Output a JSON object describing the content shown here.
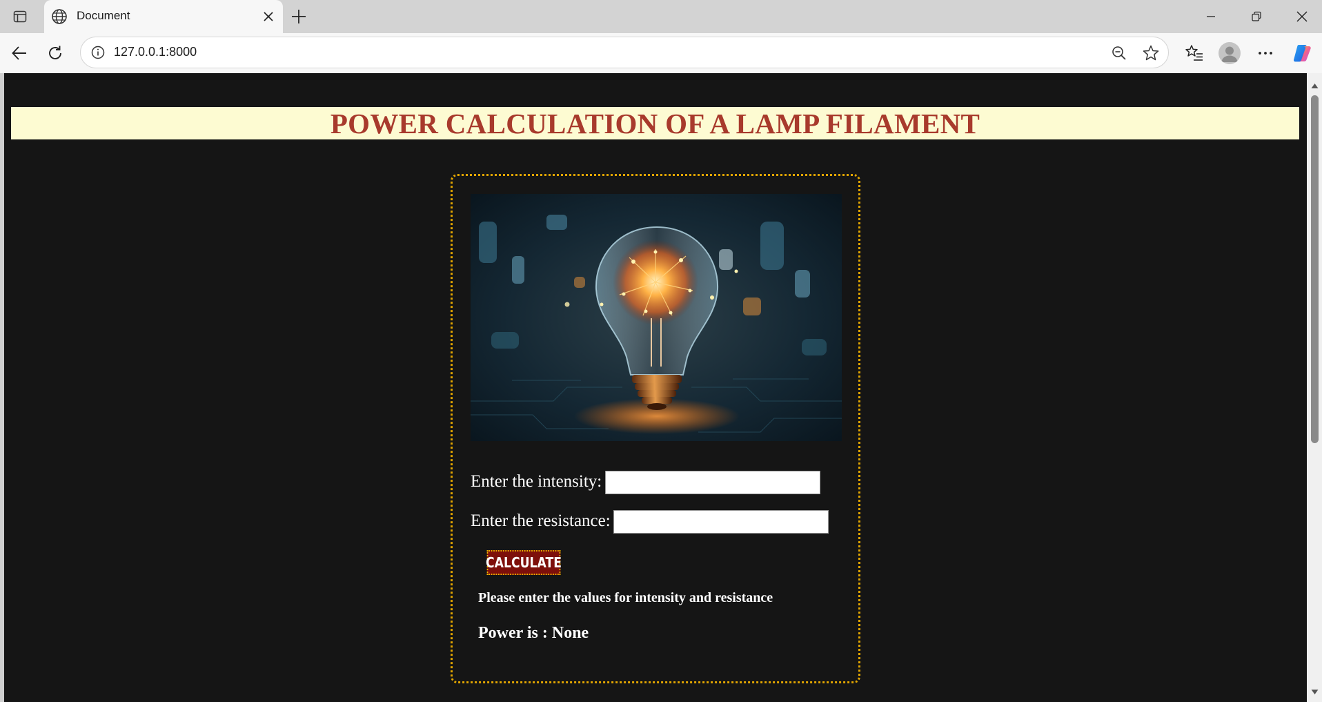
{
  "browser": {
    "tab": {
      "title": "Document"
    },
    "address_bar": {
      "url": "127.0.0.1:8000"
    }
  },
  "page": {
    "heading": "POWER CALCULATION OF A LAMP FILAMENT",
    "image": {
      "subject": "glowing light bulb",
      "icon": "lightbulb-illustration"
    },
    "form": {
      "intensity_label": "Enter the intensity:",
      "intensity_value": "",
      "resistance_label": "Enter the resistance:",
      "resistance_value": "",
      "calculate_label": "CALCULATE"
    },
    "message": "Please enter the values for intensity and resistance",
    "result": "Power is : None"
  },
  "colors": {
    "page_background": "#151515",
    "heading_band": "#fdfbd2",
    "heading_text": "#a83a2c",
    "card_border": "#e0a400",
    "button_background": "#7d0f0b"
  }
}
